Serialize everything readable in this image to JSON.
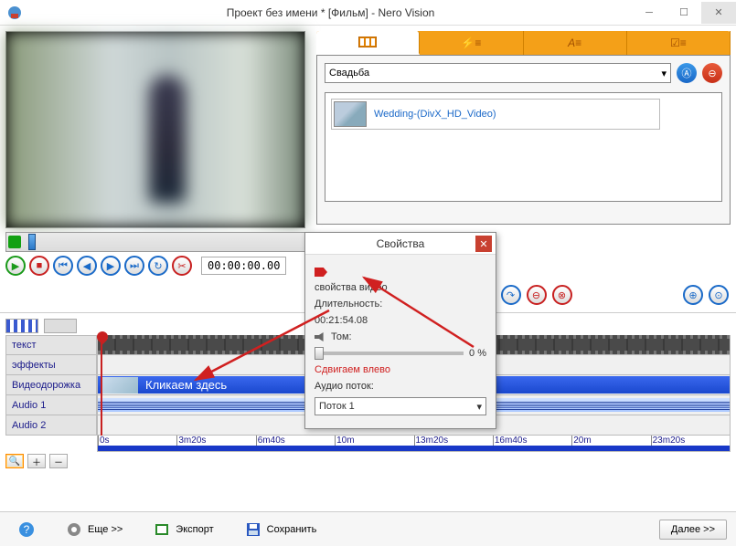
{
  "window": {
    "title": "Проект без имени * [Фильм] - Nero Vision"
  },
  "transport": {
    "timecode": "00:00:00.00"
  },
  "mediaPanel": {
    "comboValue": "Свадьба",
    "item": "Wedding-(DivX_HD_Video)"
  },
  "timeline": {
    "tracks": {
      "text": "текст",
      "effects": "эффекты",
      "video": "Видеодорожка",
      "audio1": "Audio 1",
      "audio2": "Audio 2"
    },
    "clipLabel": "Кликаем здесь",
    "ticks": [
      "0s",
      "3m20s",
      "6m40s",
      "10m",
      "13m20s",
      "16m40s",
      "20m",
      "23m20s"
    ]
  },
  "dialog": {
    "title": "Свойства",
    "section": "свойства видео",
    "durationLabel": "Длительность:",
    "durationValue": "00:21:54.08",
    "volumeLabel": "Том:",
    "volumeValue": "0 %",
    "slideNote": "Сдвигаем влево",
    "audioStreamLabel": "Аудио поток:",
    "audioStream": "Поток 1"
  },
  "bottomBar": {
    "more": "Еще >>",
    "export": "Экспорт",
    "save": "Сохранить",
    "next": "Далее >>"
  }
}
